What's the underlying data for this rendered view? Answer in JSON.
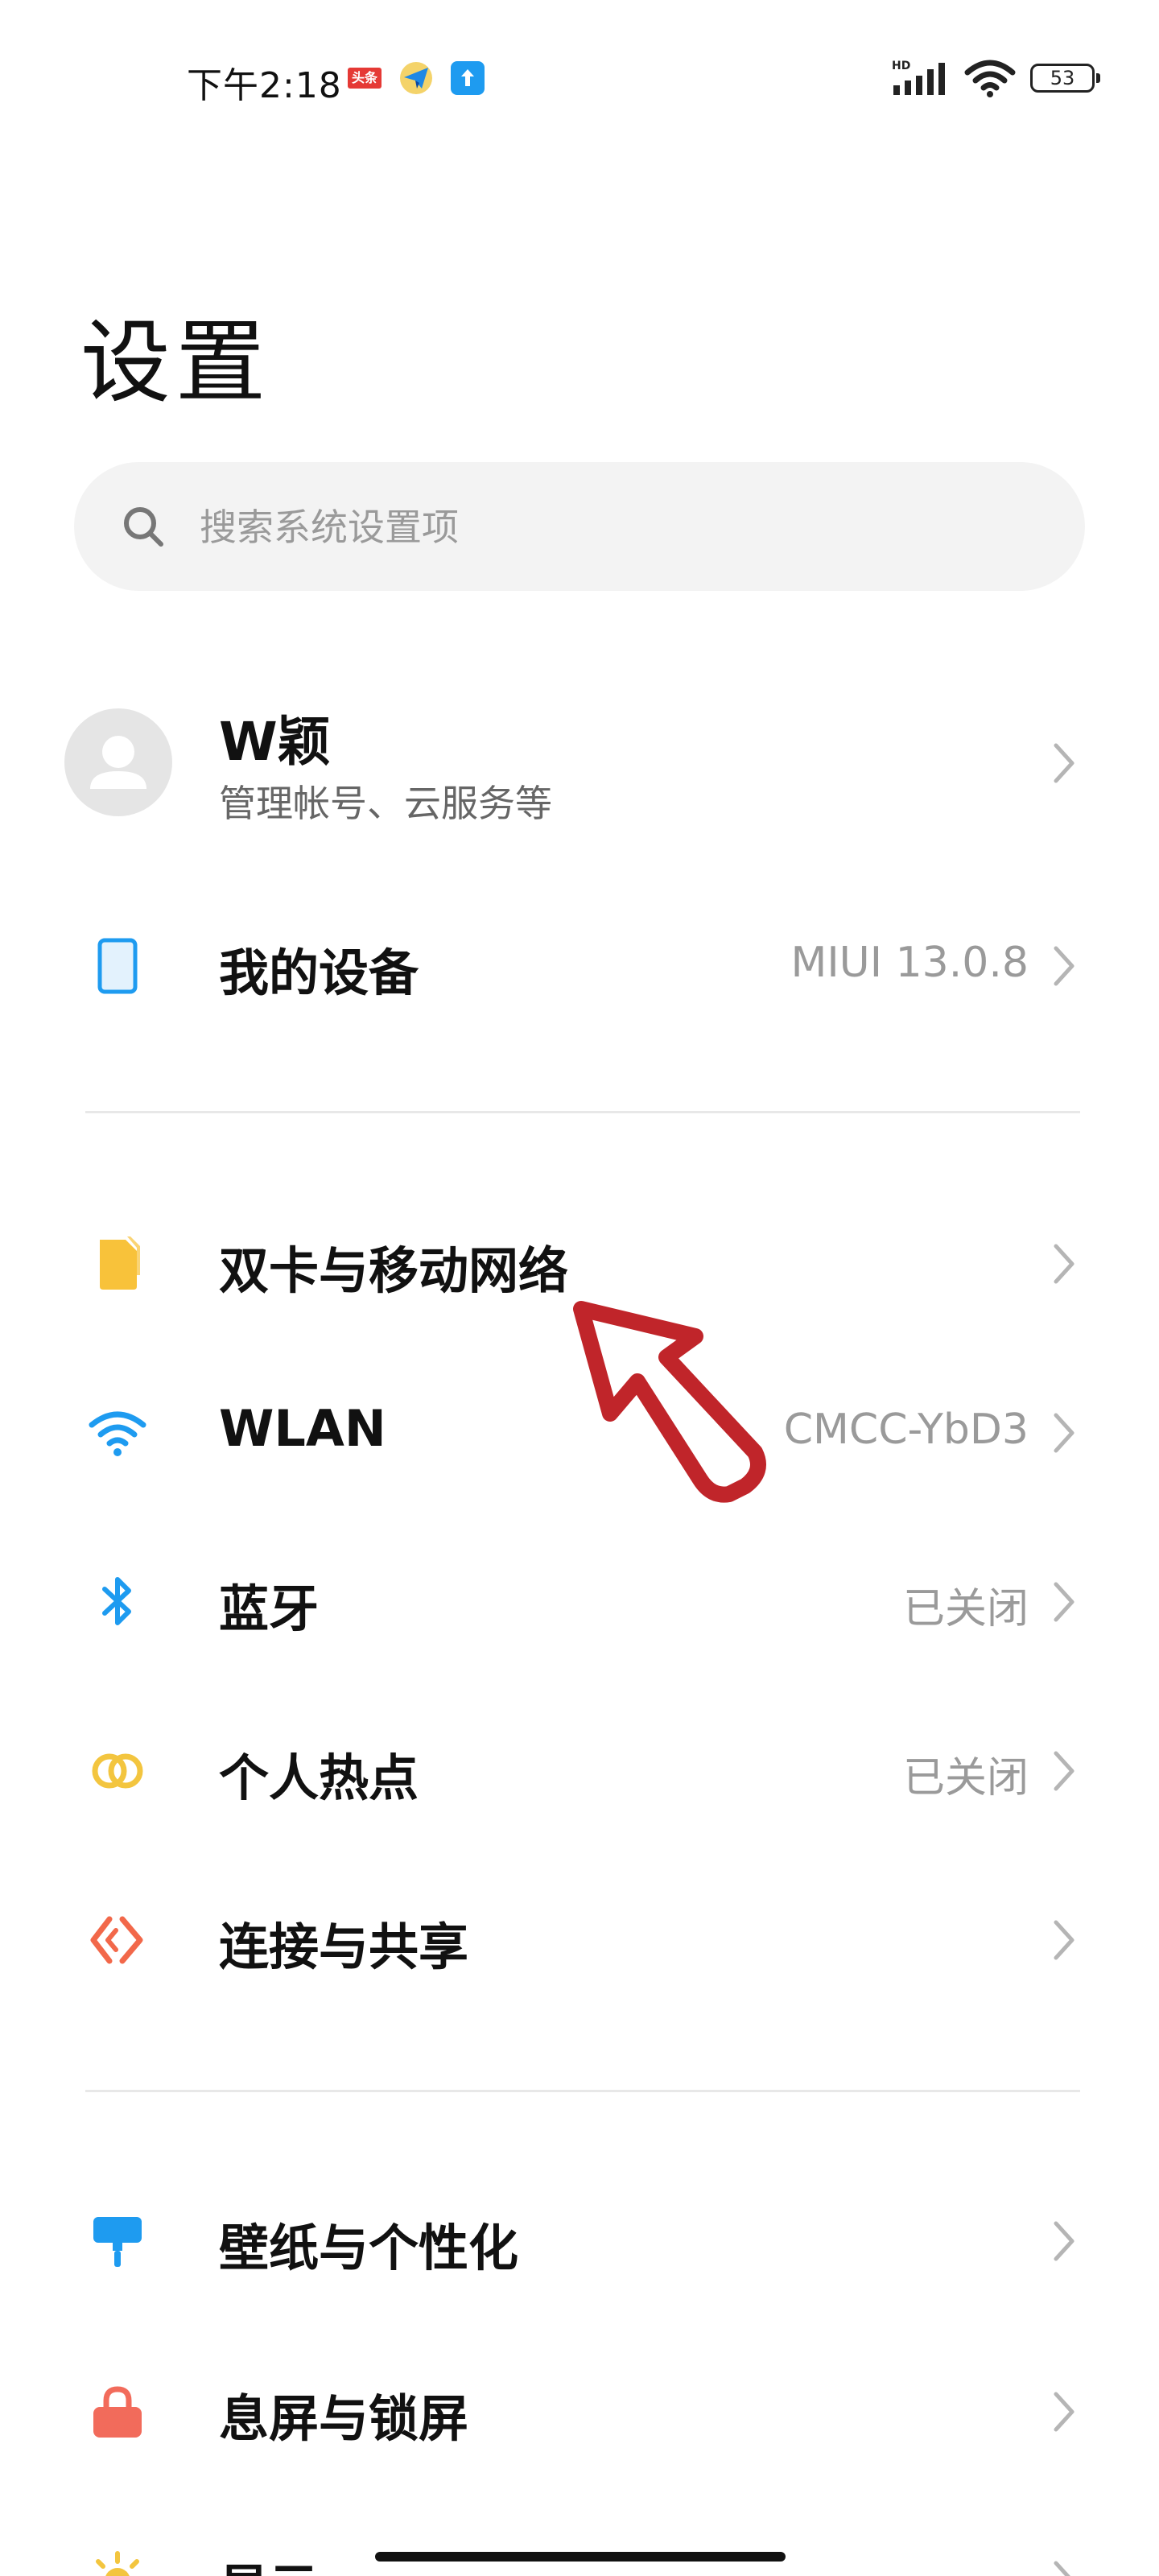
{
  "status_bar": {
    "time": "下午2:18",
    "badge_text": "头条",
    "network_label": "HD",
    "battery": "53"
  },
  "page": {
    "title": "设置"
  },
  "search": {
    "placeholder": "搜索系统设置项"
  },
  "account": {
    "name": "W颖",
    "subtitle": "管理帐号、云服务等"
  },
  "sections": {
    "device": {
      "label": "我的设备",
      "value": "MIUI 13.0.8"
    },
    "sim": {
      "label": "双卡与移动网络"
    },
    "wlan": {
      "label": "WLAN",
      "value": "CMCC-YbD3"
    },
    "bluetooth": {
      "label": "蓝牙",
      "value": "已关闭"
    },
    "hotspot": {
      "label": "个人热点",
      "value": "已关闭"
    },
    "connection": {
      "label": "连接与共享"
    },
    "wallpaper": {
      "label": "壁纸与个性化"
    },
    "lockscreen": {
      "label": "息屏与锁屏"
    },
    "display": {
      "label": "显示"
    }
  },
  "colors": {
    "accent_blue": "#1e9bf0",
    "sim_yellow": "#f8c23a",
    "hotspot_yellow": "#f3c53f",
    "share_orange": "#f2684a",
    "lock_red": "#f26b5b",
    "annotation_red": "#c0252a"
  },
  "icons": {
    "device": "tablet-icon",
    "sim": "sim-card-icon",
    "wlan": "wifi-icon",
    "bluetooth": "bluetooth-icon",
    "hotspot": "hotspot-icon",
    "connection": "share-icon",
    "wallpaper": "paint-roller-icon",
    "lockscreen": "lock-icon",
    "display": "sun-icon"
  }
}
